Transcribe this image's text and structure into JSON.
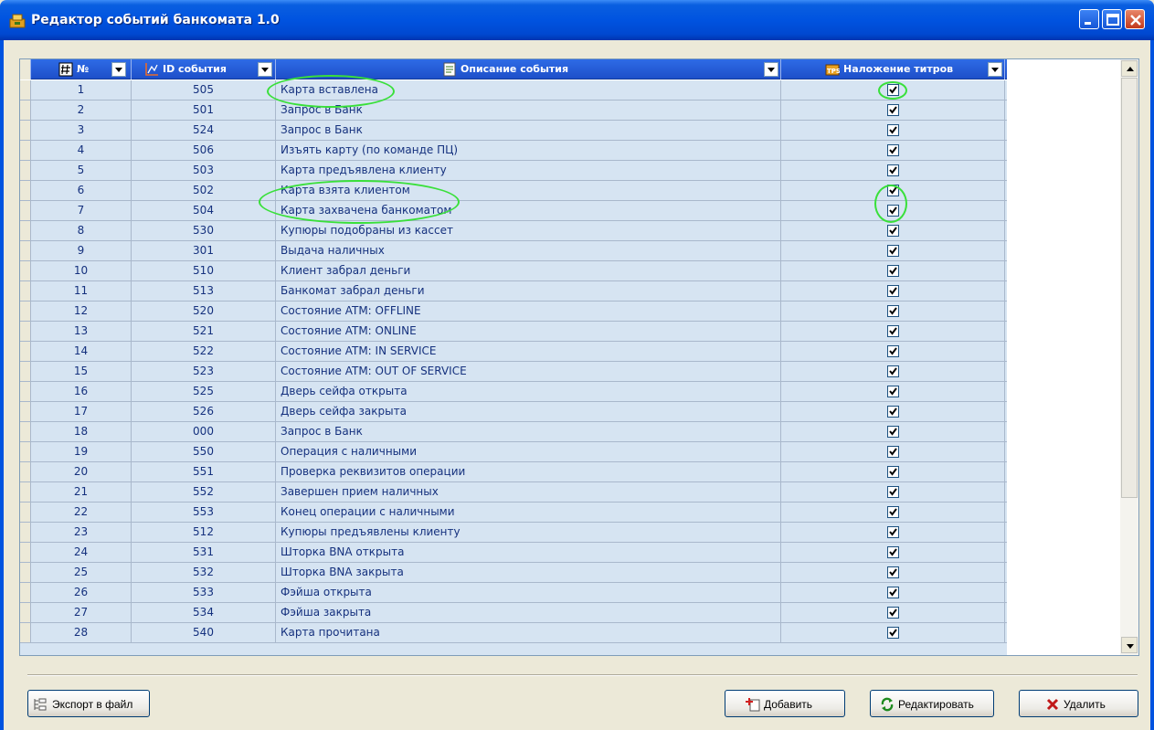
{
  "window": {
    "title": "Редактор событий банкомата 1.0"
  },
  "grid": {
    "columns": [
      {
        "label": "№",
        "icon": "hash-icon"
      },
      {
        "label": "ID события",
        "icon": "chart-icon"
      },
      {
        "label": "Описание события",
        "icon": "document-icon"
      },
      {
        "label": "Наложение титров",
        "icon": "tps-icon"
      }
    ],
    "rows": [
      {
        "num": "1",
        "id": "505",
        "desc": "Карта вставлена",
        "overlay": true
      },
      {
        "num": "2",
        "id": "501",
        "desc": "Запрос в Банк",
        "overlay": true
      },
      {
        "num": "3",
        "id": "524",
        "desc": "Запрос в Банк",
        "overlay": true
      },
      {
        "num": "4",
        "id": "506",
        "desc": "Изъять карту (по команде ПЦ)",
        "overlay": true
      },
      {
        "num": "5",
        "id": "503",
        "desc": "Карта предъявлена клиенту",
        "overlay": true
      },
      {
        "num": "6",
        "id": "502",
        "desc": "Карта взята клиентом",
        "overlay": true
      },
      {
        "num": "7",
        "id": "504",
        "desc": "Карта захвачена банкоматом",
        "overlay": true
      },
      {
        "num": "8",
        "id": "530",
        "desc": "Купюры подобраны из кассет",
        "overlay": true
      },
      {
        "num": "9",
        "id": "301",
        "desc": "Выдача наличных",
        "overlay": true
      },
      {
        "num": "10",
        "id": "510",
        "desc": "Клиент забрал деньги",
        "overlay": true
      },
      {
        "num": "11",
        "id": "513",
        "desc": "Банкомат забрал деньги",
        "overlay": true
      },
      {
        "num": "12",
        "id": "520",
        "desc": "Состояние ATM: OFFLINE",
        "overlay": true
      },
      {
        "num": "13",
        "id": "521",
        "desc": "Состояние ATM: ONLINE",
        "overlay": true
      },
      {
        "num": "14",
        "id": "522",
        "desc": "Состояние ATM: IN SERVICE",
        "overlay": true
      },
      {
        "num": "15",
        "id": "523",
        "desc": "Состояние ATM: OUT OF SERVICE",
        "overlay": true
      },
      {
        "num": "16",
        "id": "525",
        "desc": "Дверь сейфа открыта",
        "overlay": true
      },
      {
        "num": "17",
        "id": "526",
        "desc": "Дверь сейфа закрыта",
        "overlay": true
      },
      {
        "num": "18",
        "id": "000",
        "desc": "Запрос в Банк",
        "overlay": true
      },
      {
        "num": "19",
        "id": "550",
        "desc": "Операция с наличными",
        "overlay": true
      },
      {
        "num": "20",
        "id": "551",
        "desc": "Проверка реквизитов операции",
        "overlay": true
      },
      {
        "num": "21",
        "id": "552",
        "desc": "Завершен прием наличных",
        "overlay": true
      },
      {
        "num": "22",
        "id": "553",
        "desc": "Конец операции с наличными",
        "overlay": true
      },
      {
        "num": "23",
        "id": "512",
        "desc": "Купюры предъявлены клиенту",
        "overlay": true
      },
      {
        "num": "24",
        "id": "531",
        "desc": "Шторка BNA открыта",
        "overlay": true
      },
      {
        "num": "25",
        "id": "532",
        "desc": "Шторка BNA закрыта",
        "overlay": true
      },
      {
        "num": "26",
        "id": "533",
        "desc": "Фэйша открыта",
        "overlay": true
      },
      {
        "num": "27",
        "id": "534",
        "desc": "Фэйша закрыта",
        "overlay": true
      },
      {
        "num": "28",
        "id": "540",
        "desc": "Карта прочитана",
        "overlay": true
      }
    ]
  },
  "buttons": {
    "export": {
      "label": "Экспорт в файл",
      "icon": "export-icon"
    },
    "add": {
      "label": "Добавить",
      "icon": "add-icon"
    },
    "edit": {
      "label": "Редактировать",
      "icon": "refresh-icon"
    },
    "delete": {
      "label": "Удалить",
      "icon": "delete-icon"
    }
  },
  "colors": {
    "header": "#1E4FC9",
    "row": "#D6E4F2",
    "text": "#15317E",
    "annotation": "#39E03A"
  }
}
